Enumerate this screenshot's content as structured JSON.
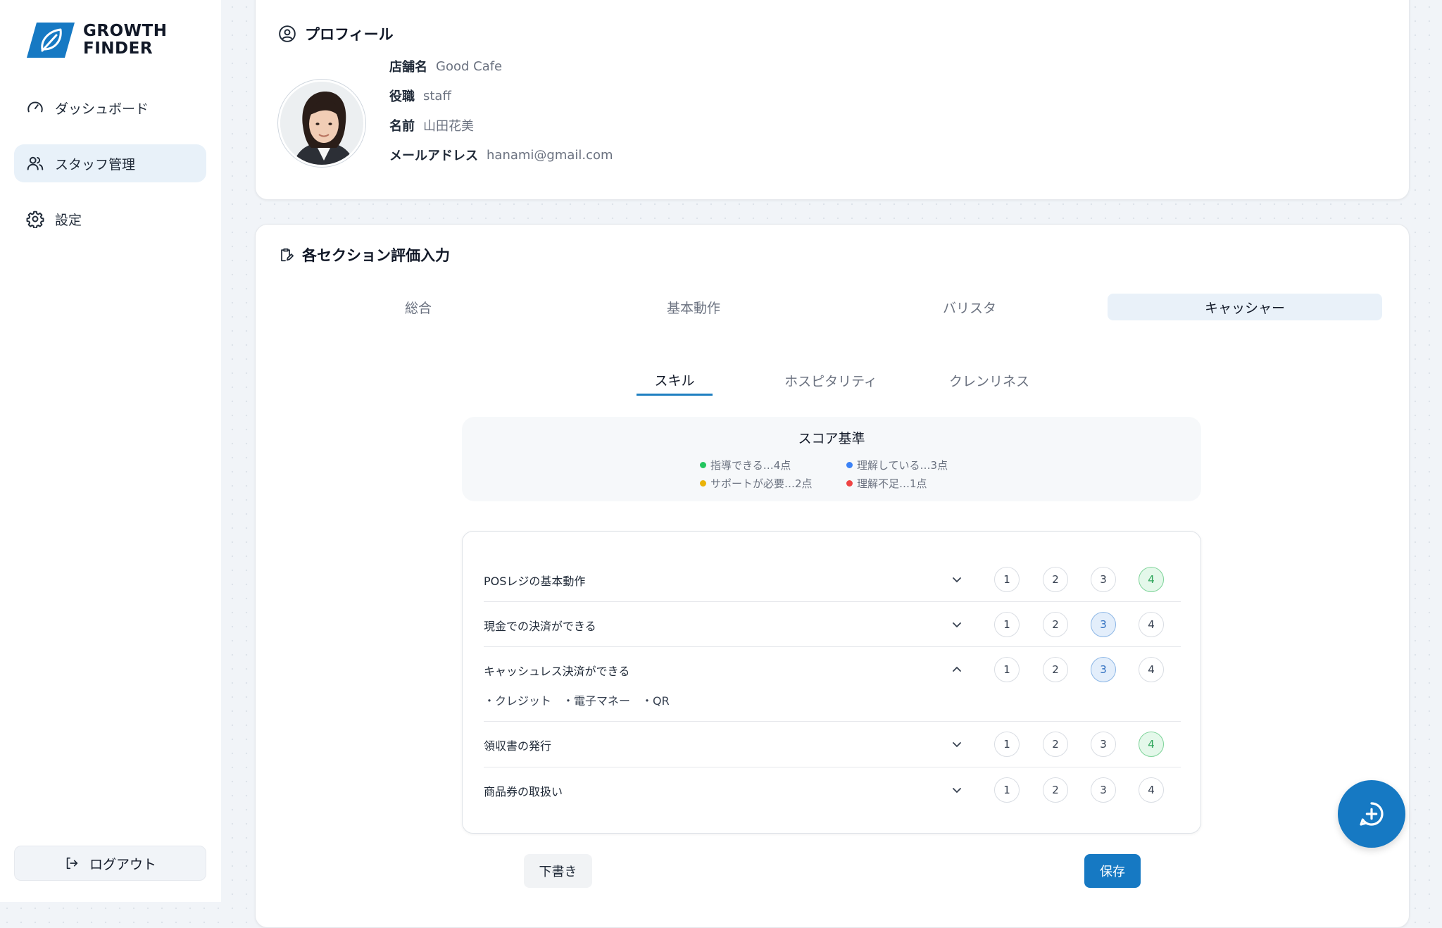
{
  "brand": {
    "line1": "GROWTH",
    "line2": "FINDER"
  },
  "sidebar": {
    "items": [
      {
        "label": "ダッシュボード",
        "icon": "gauge-icon"
      },
      {
        "label": "スタッフ管理",
        "icon": "users-icon",
        "active": true
      },
      {
        "label": "設定",
        "icon": "gear-icon"
      }
    ],
    "logout": "ログアウト"
  },
  "profile": {
    "title": "プロフィール",
    "fields": [
      {
        "key": "店舗名",
        "value": "Good Cafe"
      },
      {
        "key": "役職",
        "value": "staff"
      },
      {
        "key": "名前",
        "value": "山田花美"
      },
      {
        "key": "メールアドレス",
        "value": "hanami@gmail.com"
      }
    ]
  },
  "evaluation": {
    "title": "各セクション評価入力",
    "tabs": [
      "総合",
      "基本動作",
      "バリスタ",
      "キャッシャー"
    ],
    "active_tab": "キャッシャー",
    "subtabs": [
      "スキル",
      "ホスピタリティ",
      "クレンリネス"
    ],
    "active_subtab": "スキル",
    "legend": {
      "title": "スコア基準",
      "items": [
        {
          "label": "指導できる…4点",
          "color": "#22c55e"
        },
        {
          "label": "理解している…3点",
          "color": "#3b82f6"
        },
        {
          "label": "サポートが必要…2点",
          "color": "#eab308"
        },
        {
          "label": "理解不足…1点",
          "color": "#ef4444"
        }
      ]
    },
    "score_options": [
      "1",
      "2",
      "3",
      "4"
    ],
    "skills": [
      {
        "label": "POSレジの基本動作",
        "selected": 4,
        "expanded": false
      },
      {
        "label": "現金での決済ができる",
        "selected": 3,
        "expanded": false
      },
      {
        "label": "キャッシュレス決済ができる",
        "selected": 3,
        "expanded": true,
        "detail": "・クレジット　・電子マネー　・QR"
      },
      {
        "label": "領収書の発行",
        "selected": 4,
        "expanded": false
      },
      {
        "label": "商品券の取扱い",
        "selected": null,
        "expanded": false
      }
    ],
    "draft_button": "下書き",
    "save_button": "保存"
  },
  "colors": {
    "primary": "#1679c3",
    "active_bg": "#e8f1f9"
  }
}
